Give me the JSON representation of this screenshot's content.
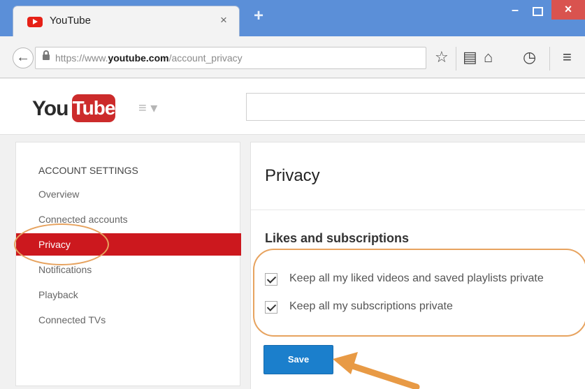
{
  "browser": {
    "tab_title": "YouTube",
    "tab_close": "×",
    "new_tab": "+",
    "minimize": "–",
    "close": "×",
    "back": "←",
    "url_prefix": "https://www.",
    "url_domain": "youtube.com",
    "url_path": "/account_privacy",
    "icons": [
      "star-icon",
      "clipboard-icon",
      "home-icon",
      "history-icon",
      "menu-icon"
    ],
    "icon_glyphs": {
      "star": "☆",
      "clipboard": "▤",
      "home": "⌂",
      "history": "◷",
      "menu": "≡"
    }
  },
  "youtube": {
    "logo_you": "You",
    "logo_tube": "Tube",
    "guide_icon": "≡ ▾"
  },
  "sidebar": {
    "heading": "ACCOUNT SETTINGS",
    "items": [
      {
        "label": "Overview"
      },
      {
        "label": "Connected accounts"
      },
      {
        "label": "Privacy",
        "active": true
      },
      {
        "label": "Notifications"
      },
      {
        "label": "Playback"
      },
      {
        "label": "Connected TVs"
      }
    ]
  },
  "main": {
    "title": "Privacy",
    "section_title": "Likes and subscriptions",
    "options": [
      {
        "label": "Keep all my liked videos and saved playlists private",
        "checked": true
      },
      {
        "label": "Keep all my subscriptions private",
        "checked": true
      }
    ],
    "save_label": "Save"
  },
  "colors": {
    "titlebar": "#5b8fd8",
    "youtube_red": "#cc181e",
    "save_blue": "#1b7fcc",
    "annotation": "#e7a35f"
  }
}
